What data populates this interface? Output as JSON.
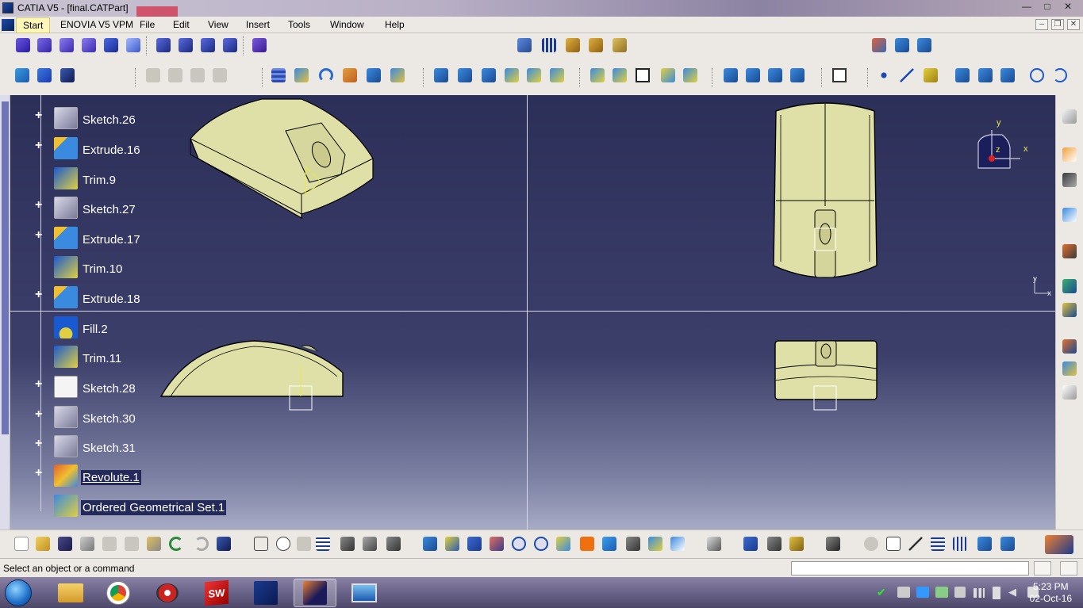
{
  "window": {
    "title": "CATIA V5 - [final.CATPart]",
    "minimize": "—",
    "maximize": "□",
    "close": "✕"
  },
  "menubar": {
    "items": [
      "Start",
      "ENOVIA V5 VPM",
      "File",
      "Edit",
      "View",
      "Insert",
      "Tools",
      "Window",
      "Help"
    ]
  },
  "tree": {
    "items": [
      {
        "label": "Sketch.26",
        "icon": "sketch-icon",
        "expandable": true
      },
      {
        "label": "Extrude.16",
        "icon": "extrude-icon",
        "expandable": true
      },
      {
        "label": "Trim.9",
        "icon": "trim-icon",
        "expandable": false
      },
      {
        "label": "Sketch.27",
        "icon": "sketch-icon",
        "expandable": true
      },
      {
        "label": "Extrude.17",
        "icon": "extrude-icon",
        "expandable": true
      },
      {
        "label": "Trim.10",
        "icon": "trim-icon",
        "expandable": false
      },
      {
        "label": "Extrude.18",
        "icon": "extrude-icon",
        "expandable": true
      },
      {
        "label": "Fill.2",
        "icon": "fill-icon",
        "expandable": false
      },
      {
        "label": "Trim.11",
        "icon": "trim-icon",
        "expandable": false
      },
      {
        "label": "Sketch.28",
        "icon": "sketch-icon",
        "expandable": true
      },
      {
        "label": "Sketch.30",
        "icon": "sketch-icon",
        "expandable": true
      },
      {
        "label": "Sketch.31",
        "icon": "sketch-icon",
        "expandable": true
      },
      {
        "label": "Revolute.1",
        "icon": "revolute-icon",
        "expandable": true
      },
      {
        "label": "Ordered Geometrical Set.1",
        "icon": "geometrical-set-icon",
        "expandable": false
      }
    ]
  },
  "compass": {
    "x": "x",
    "y": "y",
    "z": "z"
  },
  "axis_small": {
    "x": "x",
    "y": "y"
  },
  "status": {
    "message": "Select an object or a command"
  },
  "taskbar": {
    "time": "5:23 PM",
    "date": "02-Oct-16"
  },
  "colors": {
    "viewport_top": "#2c2f58",
    "model": "#e2e3a8",
    "tree_highlight": "#232a5a"
  }
}
